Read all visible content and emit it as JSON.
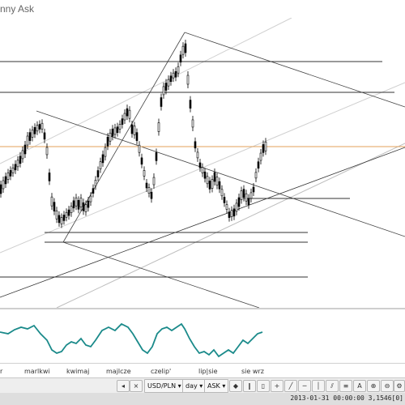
{
  "window": {
    "title": "nny Ask"
  },
  "x_axis": {
    "labels": [
      {
        "text": "r"
      },
      {
        "text": "marlkwi"
      },
      {
        "text": "kwimaj"
      },
      {
        "text": "majlcze"
      },
      {
        "text": "czelip'"
      },
      {
        "text": "lip|sie"
      },
      {
        "text": "sie wrz"
      }
    ]
  },
  "toolbar": {
    "symbol": "USD/PLN",
    "timeframe": "day",
    "price_type": "ASK",
    "close_glyph": "×",
    "prev_glyph": "◂",
    "icons": [
      "chart-type-icon",
      "bar-chart-icon",
      "candles-icon",
      "crosshair-icon",
      "trendline-icon",
      "hline-icon",
      "vline-icon",
      "channel-icon",
      "fibo-icon",
      "text-icon",
      "zoom-in-icon",
      "zoom-out-icon",
      "settings-icon"
    ]
  },
  "status": {
    "text": "2013-01-31 00:00:00  3,1546[0]"
  },
  "colors": {
    "price_line": "#e3a25a",
    "oscillator": "#1a8a8a",
    "candles": "#000000",
    "levels": "#333333",
    "channels": "#cfcfcf"
  }
}
